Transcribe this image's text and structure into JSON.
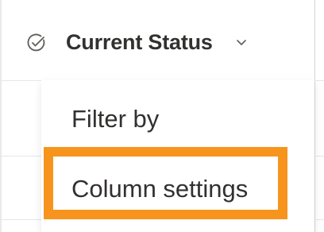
{
  "column_header": {
    "title": "Current Status",
    "icon": "circle-check-icon",
    "dropdown_icon": "chevron-down-icon"
  },
  "menu": {
    "items": [
      {
        "label": "Filter by"
      },
      {
        "label": "Column settings",
        "highlighted": true
      }
    ]
  },
  "colors": {
    "text": "#323130",
    "highlight": "#f7941d",
    "icon": "#605e5c"
  }
}
